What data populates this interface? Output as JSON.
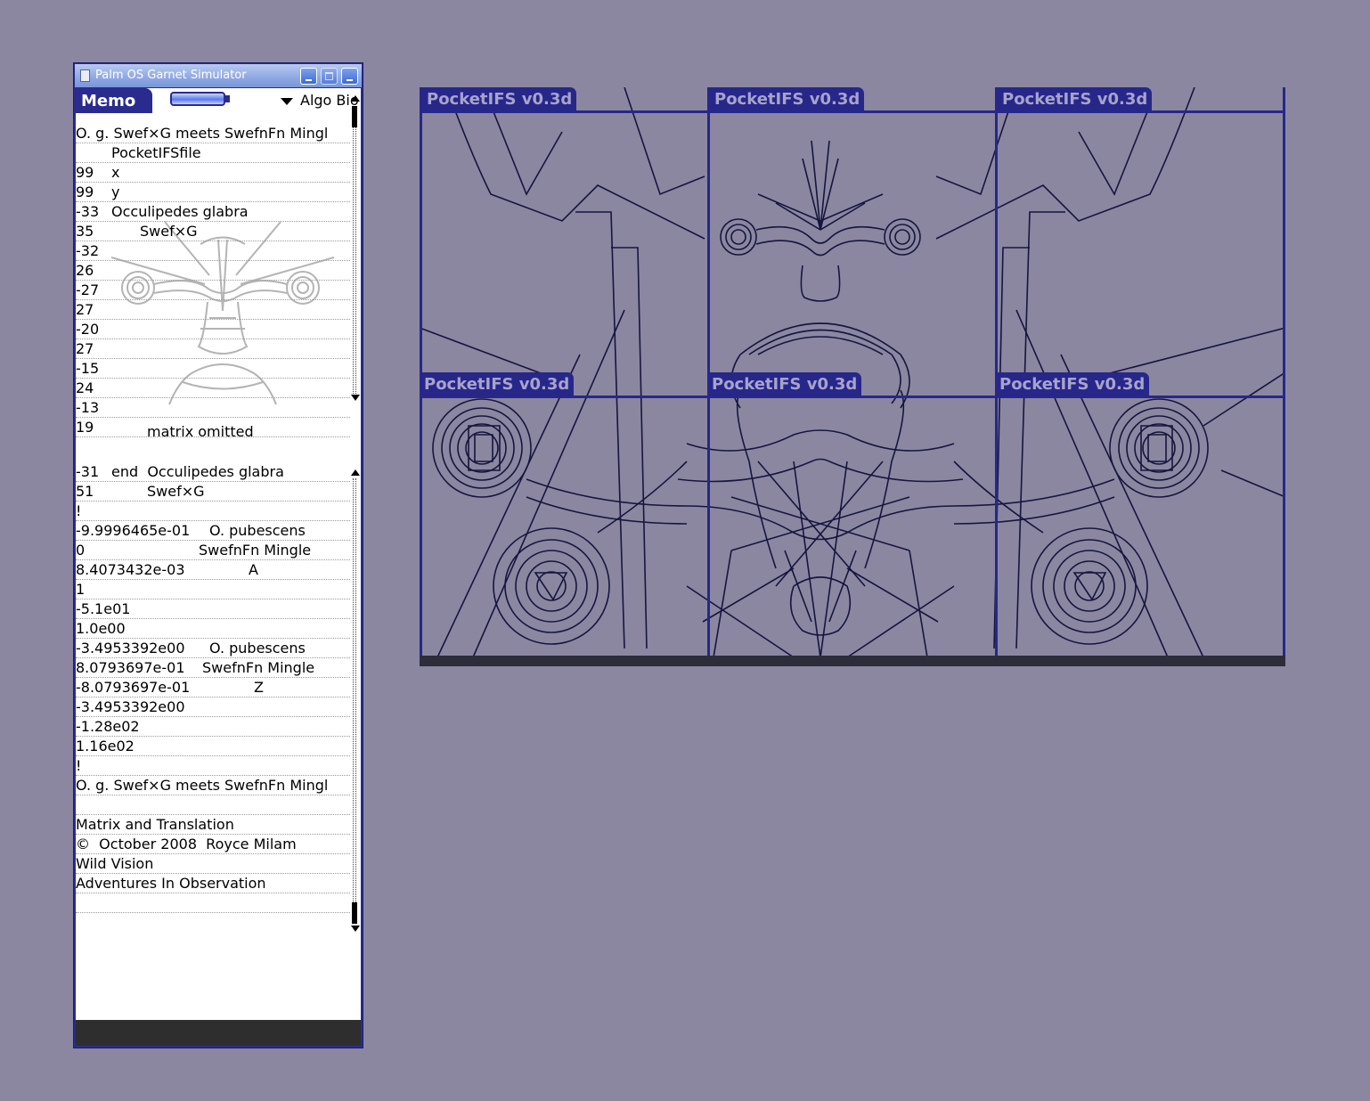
{
  "window": {
    "title": "Palm OS Garnet Simulator",
    "buttons": [
      "minimize",
      "maximize",
      "close"
    ]
  },
  "memo": {
    "tab_label": "Memo",
    "category": "Algo Bio",
    "top_lines": [
      {
        "a": "O. g. Swef×G meets SwefnFn Mingl",
        "b": ""
      },
      {
        "a": "",
        "b": "PocketIFSfile"
      },
      {
        "a": "99",
        "b": "x"
      },
      {
        "a": "99",
        "b": "y"
      },
      {
        "a": "-33",
        "b": "Occulipedes glabra"
      },
      {
        "a": "35",
        "b": "Swef×G"
      },
      {
        "a": "-32",
        "b": ""
      },
      {
        "a": "26",
        "b": ""
      },
      {
        "a": "-27",
        "b": ""
      },
      {
        "a": "27",
        "b": ""
      },
      {
        "a": "-20",
        "b": ""
      },
      {
        "a": "27",
        "b": ""
      },
      {
        "a": "-15",
        "b": ""
      },
      {
        "a": "24",
        "b": ""
      },
      {
        "a": "-13",
        "b": ""
      },
      {
        "a": "19",
        "b": ""
      }
    ],
    "middle_note": "matrix omitted",
    "bottom_lines": [
      {
        "a": "-31",
        "b": "end  Occulipedes glabra"
      },
      {
        "a": "51",
        "b": "Swef×G"
      },
      {
        "a": "!",
        "b": ""
      },
      {
        "a": "-9.9996465e-01",
        "b": "O. pubescens"
      },
      {
        "a": "0",
        "b": "SwefnFn Mingle"
      },
      {
        "a": "8.4073432e-03",
        "b": "A"
      },
      {
        "a": "1",
        "b": ""
      },
      {
        "a": "-5.1e01",
        "b": ""
      },
      {
        "a": "1.0e00",
        "b": ""
      },
      {
        "a": "-3.4953392e00",
        "b": "O. pubescens"
      },
      {
        "a": "8.0793697e-01",
        "b": "SwefnFn Mingle"
      },
      {
        "a": "-8.0793697e-01",
        "b": "Z"
      },
      {
        "a": "-3.4953392e00",
        "b": ""
      },
      {
        "a": "-1.28e02",
        "b": ""
      },
      {
        "a": "1.16e02",
        "b": ""
      },
      {
        "a": "!",
        "b": ""
      },
      {
        "a": "O. g. Swef×G meets SwefnFn Mingl",
        "b": ""
      },
      {
        "a": "",
        "b": ""
      },
      {
        "a": "Matrix and Translation",
        "b": ""
      },
      {
        "a": "©  October 2008  Royce Milam",
        "b": ""
      },
      {
        "a": "Wild Vision",
        "b": ""
      },
      {
        "a": "Adventures In Observation",
        "b": ""
      },
      {
        "a": "",
        "b": ""
      }
    ]
  },
  "panes": [
    {
      "title": "PocketIFS v0.3d"
    },
    {
      "title": "PocketIFS v0.3d"
    },
    {
      "title": "PocketIFS v0.3d"
    },
    {
      "title": "PocketIFS v0.3d"
    },
    {
      "title": "PocketIFS v0.3d"
    },
    {
      "title": "PocketIFS v0.3d"
    }
  ],
  "colors": {
    "desktop": "#8b87a1",
    "palm_accent": "#2a2b8f",
    "drawing_stroke": "#16153d",
    "face_stroke": "#b4b4b4"
  }
}
